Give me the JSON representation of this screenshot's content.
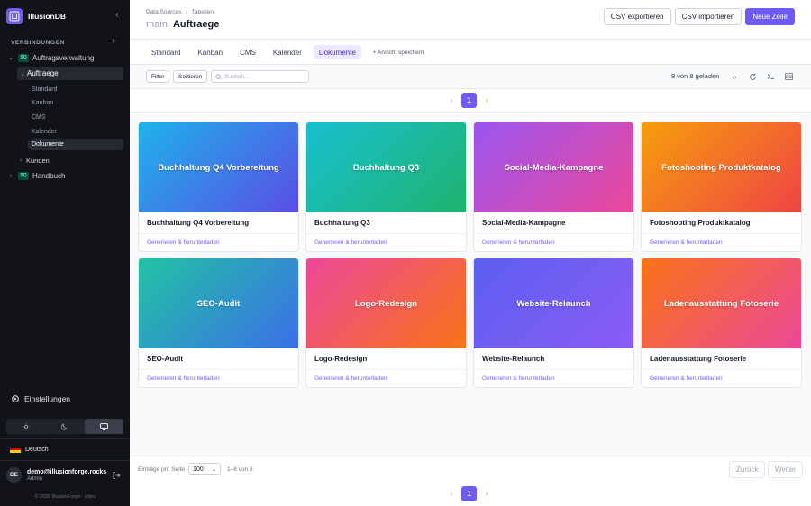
{
  "sidebar": {
    "app_name": "IllusionDB",
    "section_label": "VERBINDUNGEN",
    "connections": [
      {
        "badge": "SQ",
        "label": "Auftragsverwaltung"
      },
      {
        "badge": "SQ",
        "label": "Handbuch"
      }
    ],
    "table_active": "Auftraege",
    "views": [
      "Standard",
      "Kanban",
      "CMS",
      "Kalender",
      "Dokumente"
    ],
    "table_other": "Kunden",
    "settings_label": "Einstellungen",
    "language": "Deutsch",
    "user": {
      "initials": "DE",
      "email": "demo@illusionforge.rocks",
      "role": "Admin"
    },
    "copyright": "© 2026 IllusionForge · vdev"
  },
  "header": {
    "breadcrumb": [
      "Data Sources",
      "/",
      "Tabellen"
    ],
    "schema": "main.",
    "table": "Auftraege",
    "buttons": {
      "export": "CSV exportieren",
      "import": "CSV importieren",
      "new_row": "Neue Zeile"
    }
  },
  "tabs": [
    "Standard",
    "Kanban",
    "CMS",
    "Kalender",
    "Dokumente"
  ],
  "active_tab": "Dokumente",
  "save_view": "+ Ansicht speichern",
  "toolbar": {
    "filter": "Filter",
    "sort": "Sortieren",
    "search_placeholder": "Suchen...",
    "loaded": "8 von 8 geladen"
  },
  "pagination": {
    "current": "1"
  },
  "cards": [
    {
      "title": "Buchhaltung Q4 Vorbereitung",
      "link": "Generieren & herunterladen",
      "gradient": [
        "#1eb3ea",
        "#5b4ee6"
      ]
    },
    {
      "title": "Buchhaltung Q3",
      "link": "Generieren & herunterladen",
      "gradient": [
        "#18c0d0",
        "#1fb36d"
      ]
    },
    {
      "title": "Social-Media-Kampagne",
      "link": "Generieren & herunterladen",
      "gradient": [
        "#9b55f0",
        "#ec4899"
      ]
    },
    {
      "title": "Fotoshooting Produktkatalog",
      "link": "Generieren & herunterladen",
      "gradient": [
        "#f59e0b",
        "#ef4444"
      ]
    },
    {
      "title": "SEO-Audit",
      "link": "Generieren & herunterladen",
      "gradient": [
        "#22c3a3",
        "#3b6fe8"
      ]
    },
    {
      "title": "Logo-Redesign",
      "link": "Generieren & herunterladen",
      "gradient": [
        "#ec4899",
        "#f97316"
      ]
    },
    {
      "title": "Website-Relaunch",
      "link": "Generieren & herunterladen",
      "gradient": [
        "#5b5ff0",
        "#8b5cf6"
      ]
    },
    {
      "title": "Ladenausstattung Fotoserie",
      "link": "Generieren & herunterladen",
      "gradient": [
        "#f97316",
        "#ec4899"
      ]
    }
  ],
  "footer": {
    "per_page_label": "Einträge pro Seite",
    "per_page_value": "100",
    "range": "1–8 von 8",
    "prev": "Zurück",
    "next": "Weiter"
  }
}
